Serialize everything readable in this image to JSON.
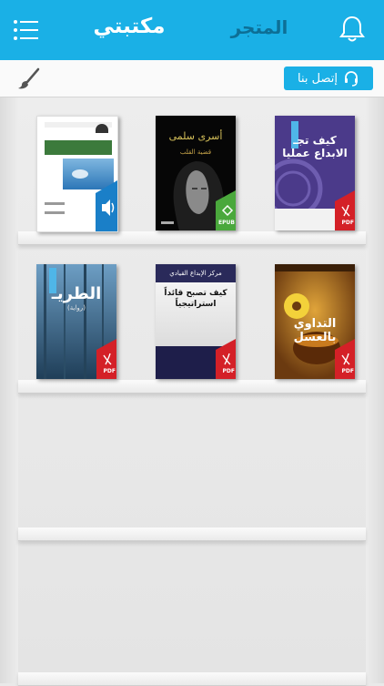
{
  "header": {
    "store_tab": "المتجر",
    "library_tab": "مكتبتي",
    "menu_icon": "hamburger-menu-icon",
    "notification_icon": "bell-icon",
    "background": "#1ab0e6"
  },
  "toolbar": {
    "contact_label": "إتصل بنا",
    "contact_icon": "headset-icon",
    "customize_icon": "paintbrush-icon"
  },
  "books": [
    {
      "title": "كيف تجـ الابداع عمليا",
      "badge": "PDF"
    },
    {
      "title": "أسرى سلمى",
      "subtitle": "قضية القلب",
      "badge": "EPUB"
    },
    {
      "title": "",
      "badge": "audio"
    },
    {
      "title": "التداوي بالعسل",
      "badge": "PDF"
    },
    {
      "title": "كيف تصبح قائداً استراتيجياً",
      "subtitle": "مركز الإبداع القيادي",
      "badge": "PDF"
    },
    {
      "title": "الطريـ",
      "subtitle": "(رواية)",
      "badge": "PDF"
    }
  ]
}
